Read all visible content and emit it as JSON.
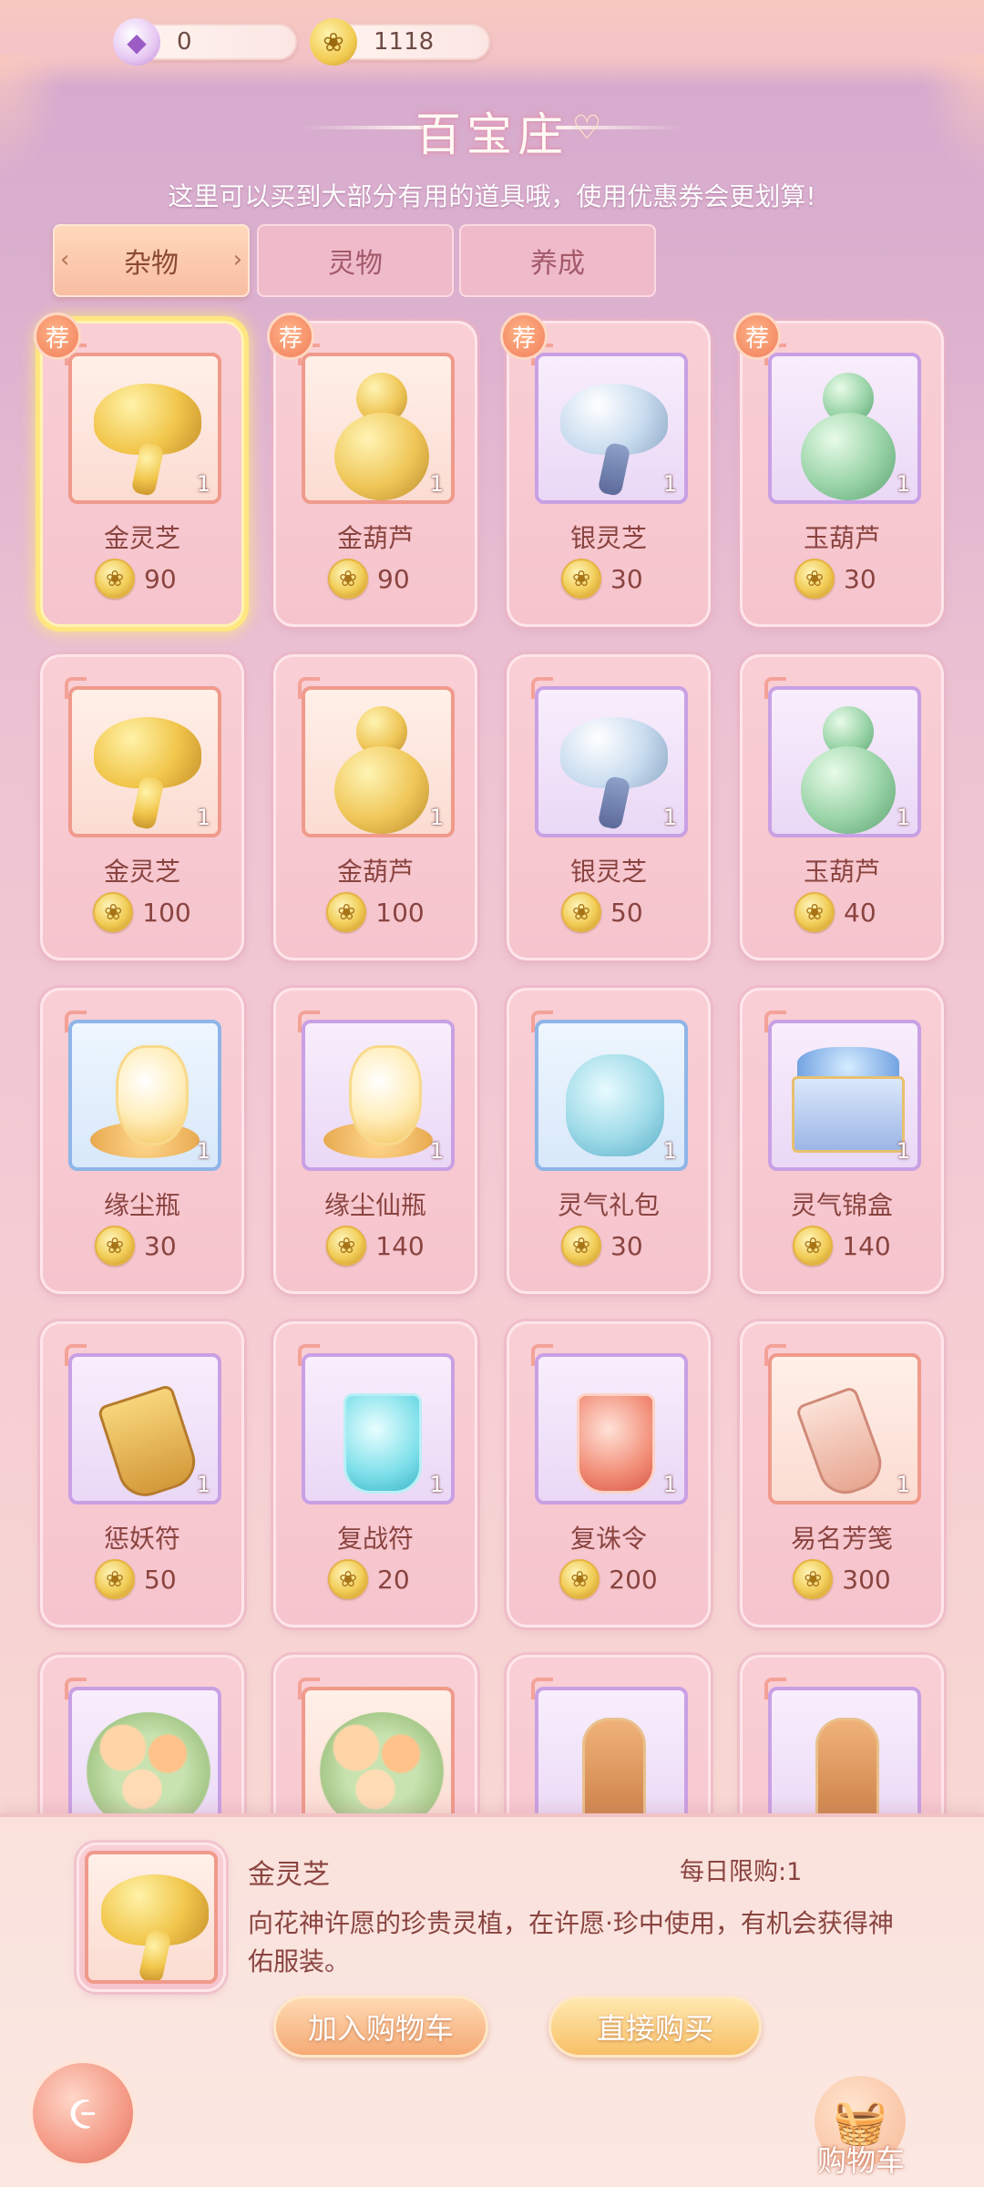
{
  "currency": {
    "gems": "0",
    "coins": "1118"
  },
  "header": {
    "title": "百宝庄",
    "subtitle": "这里可以买到大部分有用的道具哦，使用优惠券会更划算!"
  },
  "tabs": [
    {
      "label": "杂物",
      "active": true
    },
    {
      "label": "灵物",
      "active": false
    },
    {
      "label": "养成",
      "active": false
    }
  ],
  "recommend_badge": "荐",
  "items": [
    {
      "name": "金灵芝",
      "price": "90",
      "qty": "1",
      "rec": true,
      "art": "gold-lingzhi",
      "frame": "orange"
    },
    {
      "name": "金葫芦",
      "price": "90",
      "qty": "1",
      "rec": true,
      "art": "gold-gourd",
      "frame": "orange"
    },
    {
      "name": "银灵芝",
      "price": "30",
      "qty": "1",
      "rec": true,
      "art": "silver-lingzhi",
      "frame": "purple"
    },
    {
      "name": "玉葫芦",
      "price": "30",
      "qty": "1",
      "rec": true,
      "art": "jade-gourd",
      "frame": "purple"
    },
    {
      "name": "金灵芝",
      "price": "100",
      "qty": "1",
      "rec": false,
      "art": "gold-lingzhi",
      "frame": "orange"
    },
    {
      "name": "金葫芦",
      "price": "100",
      "qty": "1",
      "rec": false,
      "art": "gold-gourd",
      "frame": "orange"
    },
    {
      "name": "银灵芝",
      "price": "50",
      "qty": "1",
      "rec": false,
      "art": "silver-lingzhi",
      "frame": "purple"
    },
    {
      "name": "玉葫芦",
      "price": "40",
      "qty": "1",
      "rec": false,
      "art": "jade-gourd",
      "frame": "purple"
    },
    {
      "name": "缘尘瓶",
      "price": "30",
      "qty": "1",
      "rec": false,
      "art": "dust-bottle",
      "frame": "blue"
    },
    {
      "name": "缘尘仙瓶",
      "price": "140",
      "qty": "1",
      "rec": false,
      "art": "dust-bottle",
      "frame": "purple"
    },
    {
      "name": "灵气礼包",
      "price": "30",
      "qty": "1",
      "rec": false,
      "art": "spirit-bag",
      "frame": "blue"
    },
    {
      "name": "灵气锦盒",
      "price": "140",
      "qty": "1",
      "rec": false,
      "art": "spirit-box",
      "frame": "purple"
    },
    {
      "name": "惩妖符",
      "price": "50",
      "qty": "1",
      "rec": false,
      "art": "talisman-gold",
      "frame": "purple"
    },
    {
      "name": "复战符",
      "price": "20",
      "qty": "1",
      "rec": false,
      "art": "talisman-aqua",
      "frame": "purple"
    },
    {
      "name": "复诛令",
      "price": "200",
      "qty": "1",
      "rec": false,
      "art": "talisman-red",
      "frame": "purple"
    },
    {
      "name": "易名芳笺",
      "price": "300",
      "qty": "1",
      "rec": false,
      "art": "rename-scroll",
      "frame": "orange"
    },
    {
      "name": "",
      "price": "",
      "qty": "",
      "rec": false,
      "art": "flowers",
      "frame": "purple"
    },
    {
      "name": "",
      "price": "",
      "qty": "",
      "rec": false,
      "art": "flowers",
      "frame": "orange"
    },
    {
      "name": "",
      "price": "",
      "qty": "",
      "rec": false,
      "art": "plank",
      "frame": "purple"
    },
    {
      "name": "",
      "price": "",
      "qty": "",
      "rec": false,
      "art": "plank",
      "frame": "purple"
    }
  ],
  "detail": {
    "name": "金灵芝",
    "limit": "每日限购:1",
    "description": "向花神许愿的珍贵灵植，在许愿·珍中使用，有机会获得神佑服装。",
    "add_to_cart": "加入购物车",
    "buy_now": "直接购买"
  },
  "cart": {
    "label": "购物车"
  },
  "colors": {
    "accent": "#f5aa76",
    "selected_glow": "#ffe680",
    "card_bg": "#f7c8d0"
  }
}
